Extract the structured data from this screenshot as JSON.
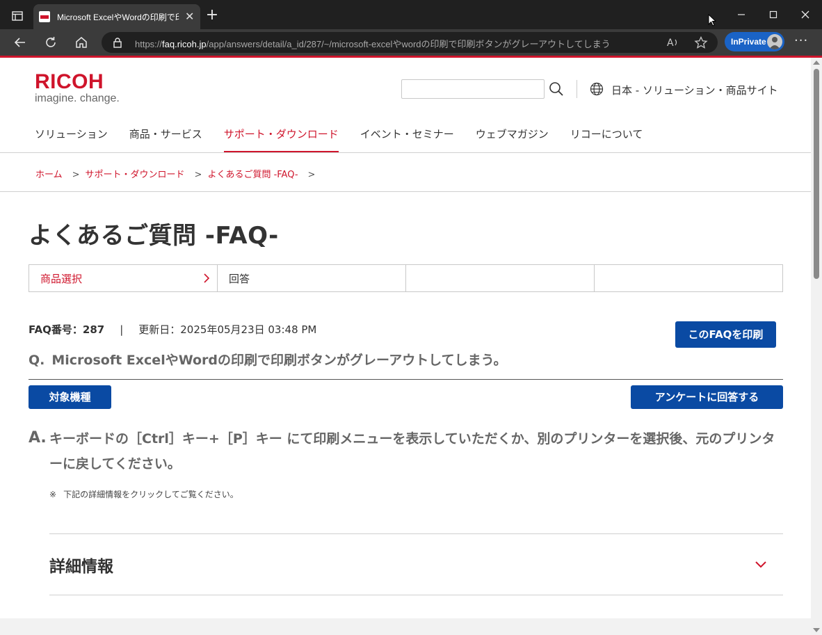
{
  "browser": {
    "tab_title": "Microsoft ExcelやWordの印刷で印刷",
    "url_prefix": "https://",
    "url_host": "faq.ricoh.jp",
    "url_path": "/app/answers/detail/a_id/287/~/microsoft-excelやwordの印刷で印刷ボタンがグレーアウトしてしまう",
    "inprivate_label": "InPrivate"
  },
  "header": {
    "brand": "RICOH",
    "tagline": "imagine. change.",
    "region": "日本 - ソリューション・商品サイト"
  },
  "nav": [
    {
      "label": "ソリューション"
    },
    {
      "label": "商品・サービス"
    },
    {
      "label": "サポート・ダウンロード"
    },
    {
      "label": "イベント・セミナー"
    },
    {
      "label": "ウェブマガジン"
    },
    {
      "label": "リコーについて"
    }
  ],
  "nav_active_index": 2,
  "breadcrumb": [
    "ホーム",
    "サポート・ダウンロード",
    "よくあるご質問 -FAQ-"
  ],
  "page": {
    "title": "よくあるご質問 -FAQ-",
    "steps": [
      "商品選択",
      "回答",
      "",
      ""
    ],
    "faq_label": "FAQ番号：287",
    "updated": "更新日：2025年05月23日 03:48 PM",
    "separator": "|",
    "print_button": "このFAQを印刷",
    "question_mark": "Q.",
    "question": "Microsoft ExcelやWordの印刷で印刷ボタンがグレーアウトしてしまう。",
    "model_button": "対象機種",
    "survey_button": "アンケートに回答する",
    "answer_mark": "A.",
    "answer": "キーボードの［Ctrl］キー+［P］キー にて印刷メニューを表示していただくか、別のプリンターを選択後、元のプリンターに戻してください。",
    "note_mark": "※",
    "note": "下記の詳細情報をクリックしてご覧ください。",
    "details_title": "詳細情報"
  },
  "colors": {
    "brand_red": "#cf142b",
    "button_blue": "#0a4aa3"
  }
}
